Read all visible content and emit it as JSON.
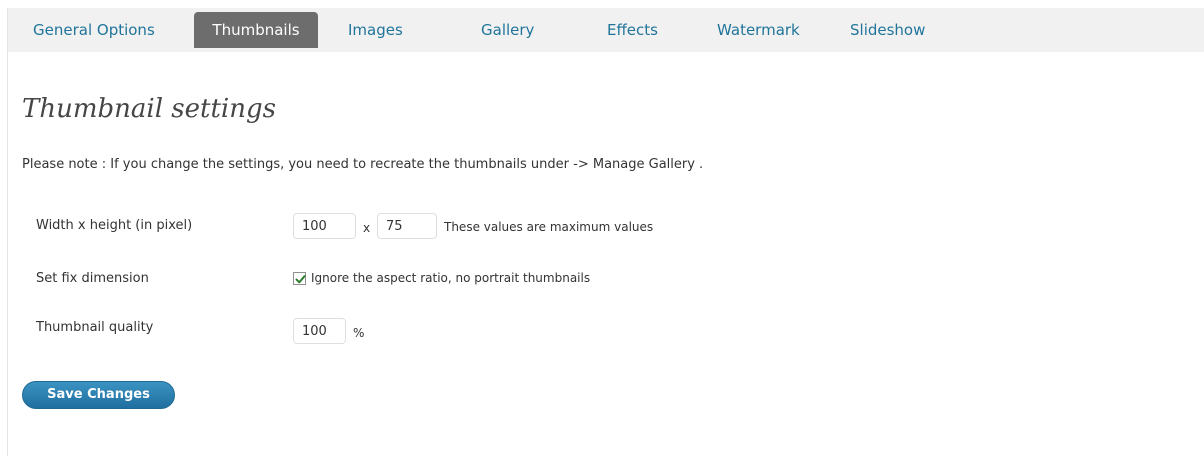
{
  "tabs": [
    {
      "label": "General Options"
    },
    {
      "label": "Thumbnails"
    },
    {
      "label": "Images"
    },
    {
      "label": "Gallery"
    },
    {
      "label": "Effects"
    },
    {
      "label": "Watermark"
    },
    {
      "label": "Slideshow"
    }
  ],
  "active_tab": "Thumbnails",
  "page": {
    "title": "Thumbnail settings",
    "note": "Please note : If you change the settings, you need to recreate the thumbnails under -> Manage Gallery ."
  },
  "form": {
    "size": {
      "label": "Width x height (in pixel)",
      "width_value": "100",
      "separator": "x",
      "height_value": "75",
      "hint": "These values are maximum values"
    },
    "fix_dimension": {
      "label": "Set fix dimension",
      "checked": true,
      "checkbox_label": "Ignore the aspect ratio, no portrait thumbnails"
    },
    "quality": {
      "label": "Thumbnail quality",
      "value": "100",
      "unit": "%"
    }
  },
  "actions": {
    "save_label": "Save Changes"
  },
  "colors": {
    "link": "#21759b",
    "active_tab_bg": "#6d6d6d",
    "tabbar_bg": "#f1f1f1",
    "button_bg": "#2a7fb0",
    "checkmark": "#2f7d2f"
  },
  "icons": {
    "checkbox_mark": "check-icon"
  }
}
